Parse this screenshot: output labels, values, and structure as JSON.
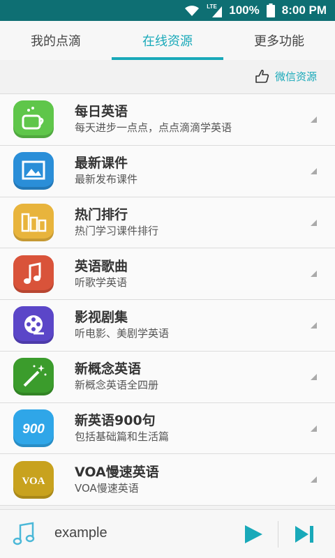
{
  "status": {
    "battery": "100%",
    "time": "8:00 PM",
    "network": "LTE"
  },
  "tabs": [
    {
      "label": "我的点滴",
      "active": false
    },
    {
      "label": "在线资源",
      "active": true
    },
    {
      "label": "更多功能",
      "active": false
    }
  ],
  "wechat": {
    "label": "微信资源",
    "icon": "thumbs-up-icon"
  },
  "list": {
    "items": [
      {
        "title": "每日英语",
        "subtitle": "每天进步一点点，点点滴滴学英语",
        "icon": "cup-icon",
        "color": "#5fc64a"
      },
      {
        "title": "最新课件",
        "subtitle": "最新发布课件",
        "icon": "picture-icon",
        "color": "#2a8ed8"
      },
      {
        "title": "热门排行",
        "subtitle": "热门学习课件排行",
        "icon": "ranking-bars-icon",
        "color": "#e8b43c"
      },
      {
        "title": "英语歌曲",
        "subtitle": "听歌学英语",
        "icon": "music-note-icon",
        "color": "#d9533a"
      },
      {
        "title": "影视剧集",
        "subtitle": "听电影、美剧学英语",
        "icon": "film-reel-icon",
        "color": "#5b46c8"
      },
      {
        "title": "新概念英语",
        "subtitle": "新概念英语全四册",
        "icon": "magic-wand-icon",
        "color": "#3b9c2c"
      },
      {
        "title": "新英语900句",
        "subtitle": "包括基础篇和生活篇",
        "icon": "900-icon",
        "color": "#2fa6e8"
      },
      {
        "title": "VOA慢速英语",
        "subtitle": "VOA慢速英语",
        "icon": "voa-icon",
        "color": "#c8a21e"
      }
    ]
  },
  "player": {
    "track": "example",
    "accent": "#19a9b9"
  }
}
